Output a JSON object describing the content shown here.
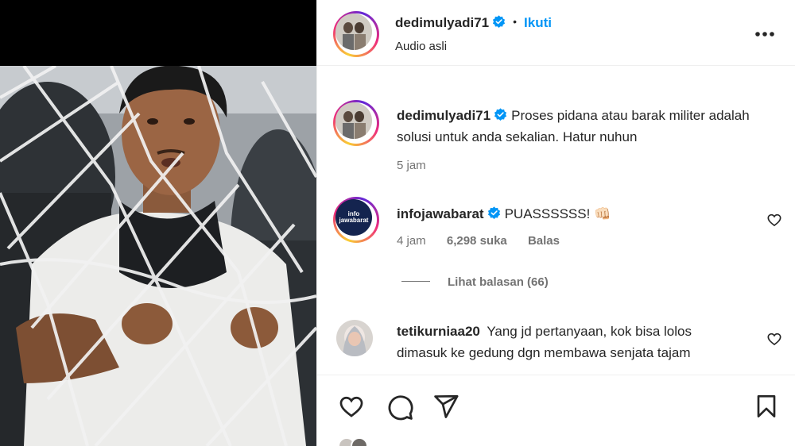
{
  "post": {
    "username": "dedimulyadi71",
    "follow_label": "Ikuti",
    "separator": "•",
    "audio_label": "Audio asli",
    "more_icon": "more-horizontal-icon"
  },
  "caption": {
    "username": "dedimulyadi71",
    "text": "Proses pidana atau barak militer adalah solusi untuk anda sekalian. Hatur nuhun",
    "time": "5 jam"
  },
  "comments": [
    {
      "username": "infojawabarat",
      "text": "PUASSSSSS! 👊🏻",
      "time": "4 jam",
      "likes": "6,298 suka",
      "reply_label": "Balas",
      "view_replies": "Lihat balasan (66)",
      "avatar_text": "info jawabarat"
    },
    {
      "username": "tetikurniaa20",
      "text": "Yang jd pertanyaan, kok bisa lolos dimasuk ke gedung dgn membawa senjata tajam"
    }
  ],
  "actions": {
    "like_icon": "heart-icon",
    "comment_icon": "comment-icon",
    "share_icon": "share-icon",
    "save_icon": "bookmark-icon"
  },
  "colors": {
    "accent": "#0095f6",
    "text": "#262626",
    "secondary": "#737373",
    "verified": "#0095f6"
  }
}
